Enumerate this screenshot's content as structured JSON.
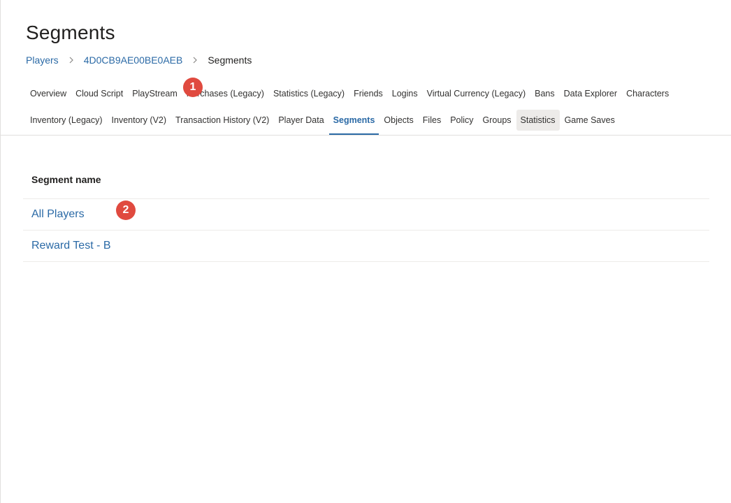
{
  "page": {
    "title": "Segments"
  },
  "breadcrumb": {
    "items": [
      {
        "label": "Players"
      },
      {
        "label": "4D0CB9AE00BE0AEB"
      },
      {
        "label": "Segments"
      }
    ]
  },
  "tabs": {
    "row1": [
      {
        "label": "Overview"
      },
      {
        "label": "Cloud Script"
      },
      {
        "label": "PlayStream"
      },
      {
        "label": "Purchases (Legacy)"
      },
      {
        "label": "Statistics (Legacy)"
      },
      {
        "label": "Friends"
      },
      {
        "label": "Logins"
      },
      {
        "label": "Virtual Currency (Legacy)"
      },
      {
        "label": "Bans"
      },
      {
        "label": "Data Explorer"
      },
      {
        "label": "Characters"
      }
    ],
    "row2": [
      {
        "label": "Inventory (Legacy)"
      },
      {
        "label": "Inventory (V2)"
      },
      {
        "label": "Transaction History (V2)"
      },
      {
        "label": "Player Data"
      },
      {
        "label": "Segments"
      },
      {
        "label": "Objects"
      },
      {
        "label": "Files"
      },
      {
        "label": "Policy"
      },
      {
        "label": "Groups"
      },
      {
        "label": "Statistics"
      },
      {
        "label": "Game Saves"
      }
    ],
    "active": "Segments",
    "hovered": "Statistics"
  },
  "table": {
    "header": "Segment name",
    "rows": [
      {
        "name": "All Players"
      },
      {
        "name": "Reward Test - B"
      }
    ]
  },
  "badges": [
    {
      "label": "1"
    },
    {
      "label": "2"
    }
  ],
  "colors": {
    "link": "#2b6aa6",
    "badge": "#e04a3f",
    "hover": "#edebe9"
  }
}
